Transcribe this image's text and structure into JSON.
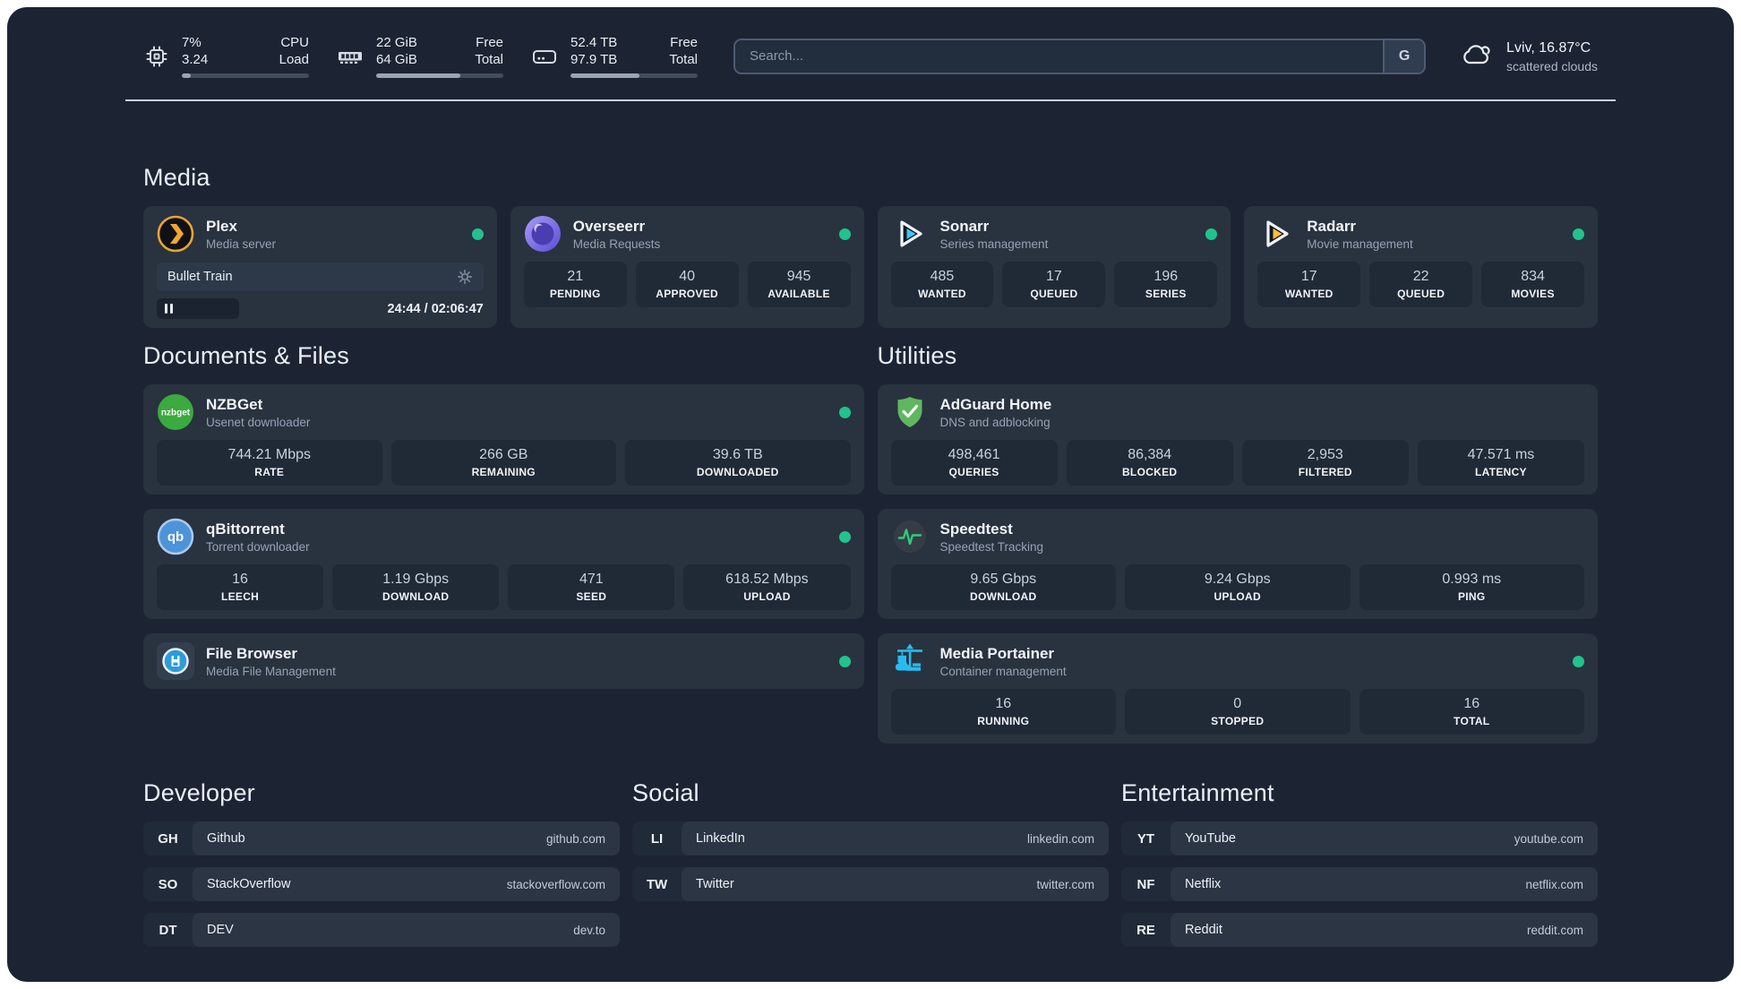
{
  "colors": {
    "background": "#1C2434",
    "card": "#29323F",
    "status_online": "#21C38D",
    "divider": "#C9D2DE",
    "plex_accent": "#F0A72E",
    "sonarr_accent": "#3EC6F4",
    "radarr_accent": "#FFBE33",
    "adguard_accent": "#5FB760",
    "speedtest_accent": "#2FCB7E",
    "portainer_accent": "#27BCF1"
  },
  "header": {
    "monitors": [
      {
        "icon": "cpu-icon",
        "values": [
          "7%",
          "3.24"
        ],
        "labels": [
          "CPU",
          "Load"
        ],
        "progress_pct": 7
      },
      {
        "icon": "memory-icon",
        "values": [
          "22 GiB",
          "64 GiB"
        ],
        "labels": [
          "Free",
          "Total"
        ],
        "progress_pct": 66
      },
      {
        "icon": "disk-icon",
        "values": [
          "52.4 TB",
          "97.9 TB"
        ],
        "labels": [
          "Free",
          "Total"
        ],
        "progress_pct": 54
      }
    ],
    "search": {
      "placeholder": "Search...",
      "provider_button": "G"
    },
    "weather": {
      "icon": "cloud-icon",
      "title": "Lviv, 16.87°C",
      "subtitle": "scattered clouds"
    }
  },
  "sections": {
    "media": {
      "title": "Media",
      "cards": [
        {
          "icon": "plex-icon",
          "name": "Plex",
          "description": "Media server",
          "status": "online",
          "player": {
            "track": "Bullet Train",
            "time": "24:44 / 02:06:47"
          }
        },
        {
          "icon": "overseerr-icon",
          "name": "Overseerr",
          "description": "Media Requests",
          "status": "online",
          "stats": [
            {
              "value": "21",
              "label": "PENDING"
            },
            {
              "value": "40",
              "label": "APPROVED"
            },
            {
              "value": "945",
              "label": "AVAILABLE"
            }
          ]
        },
        {
          "icon": "sonarr-icon",
          "name": "Sonarr",
          "description": "Series management",
          "status": "online",
          "stats": [
            {
              "value": "485",
              "label": "WANTED"
            },
            {
              "value": "17",
              "label": "QUEUED"
            },
            {
              "value": "196",
              "label": "SERIES"
            }
          ]
        },
        {
          "icon": "radarr-icon",
          "name": "Radarr",
          "description": "Movie management",
          "status": "online",
          "stats": [
            {
              "value": "17",
              "label": "WANTED"
            },
            {
              "value": "22",
              "label": "QUEUED"
            },
            {
              "value": "834",
              "label": "MOVIES"
            }
          ]
        }
      ]
    },
    "documents": {
      "title": "Documents & Files",
      "cards": [
        {
          "icon": "nzbget-icon",
          "name": "NZBGet",
          "description": "Usenet downloader",
          "status": "online",
          "stats": [
            {
              "value": "744.21 Mbps",
              "label": "RATE"
            },
            {
              "value": "266 GB",
              "label": "REMAINING"
            },
            {
              "value": "39.6 TB",
              "label": "DOWNLOADED"
            }
          ]
        },
        {
          "icon": "qbittorrent-icon",
          "name": "qBittorrent",
          "description": "Torrent downloader",
          "status": "online",
          "stats": [
            {
              "value": "16",
              "label": "LEECH"
            },
            {
              "value": "1.19 Gbps",
              "label": "DOWNLOAD"
            },
            {
              "value": "471",
              "label": "SEED"
            },
            {
              "value": "618.52 Mbps",
              "label": "UPLOAD"
            }
          ]
        },
        {
          "icon": "filebrowser-icon",
          "name": "File Browser",
          "description": "Media File Management",
          "status": "online"
        }
      ]
    },
    "utilities": {
      "title": "Utilities",
      "cards": [
        {
          "icon": "adguard-icon",
          "name": "AdGuard Home",
          "description": "DNS and adblocking",
          "stats": [
            {
              "value": "498,461",
              "label": "QUERIES"
            },
            {
              "value": "86,384",
              "label": "BLOCKED"
            },
            {
              "value": "2,953",
              "label": "FILTERED"
            },
            {
              "value": "47.571 ms",
              "label": "LATENCY"
            }
          ]
        },
        {
          "icon": "speedtest-icon",
          "name": "Speedtest",
          "description": "Speedtest Tracking",
          "stats": [
            {
              "value": "9.65 Gbps",
              "label": "DOWNLOAD"
            },
            {
              "value": "9.24 Gbps",
              "label": "UPLOAD"
            },
            {
              "value": "0.993 ms",
              "label": "PING"
            }
          ]
        },
        {
          "icon": "portainer-icon",
          "name": "Media Portainer",
          "description": "Container management",
          "status": "online",
          "stats": [
            {
              "value": "16",
              "label": "RUNNING"
            },
            {
              "value": "0",
              "label": "STOPPED"
            },
            {
              "value": "16",
              "label": "TOTAL"
            }
          ]
        }
      ]
    },
    "developer": {
      "title": "Developer",
      "links": [
        {
          "abbr": "GH",
          "name": "Github",
          "url": "github.com"
        },
        {
          "abbr": "SO",
          "name": "StackOverflow",
          "url": "stackoverflow.com"
        },
        {
          "abbr": "DT",
          "name": "DEV",
          "url": "dev.to"
        }
      ]
    },
    "social": {
      "title": "Social",
      "links": [
        {
          "abbr": "LI",
          "name": "LinkedIn",
          "url": "linkedin.com"
        },
        {
          "abbr": "TW",
          "name": "Twitter",
          "url": "twitter.com"
        }
      ]
    },
    "entertainment": {
      "title": "Entertainment",
      "links": [
        {
          "abbr": "YT",
          "name": "YouTube",
          "url": "youtube.com"
        },
        {
          "abbr": "NF",
          "name": "Netflix",
          "url": "netflix.com"
        },
        {
          "abbr": "RE",
          "name": "Reddit",
          "url": "reddit.com"
        }
      ]
    }
  }
}
